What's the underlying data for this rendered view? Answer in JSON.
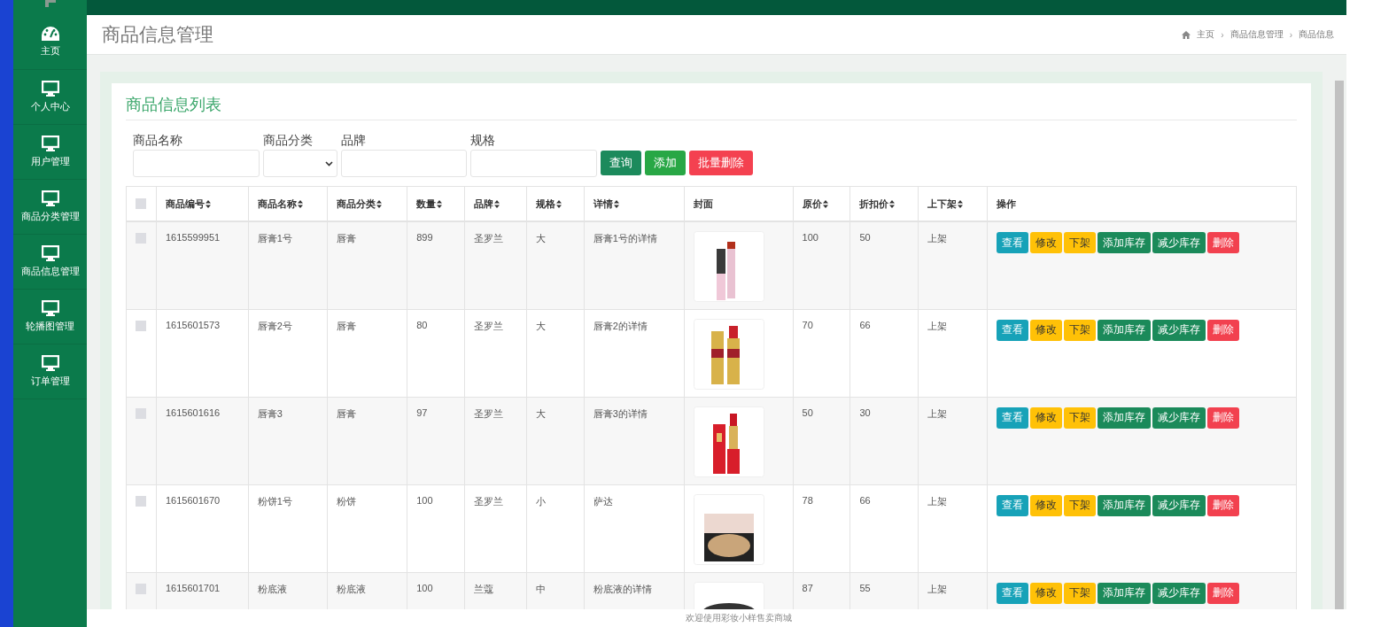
{
  "sidebar": {
    "items": [
      {
        "label": "主页"
      },
      {
        "label": "个人中心"
      },
      {
        "label": "用户管理"
      },
      {
        "label": "商品分类管理"
      },
      {
        "label": "商品信息管理"
      },
      {
        "label": "轮播图管理"
      },
      {
        "label": "订单管理"
      }
    ]
  },
  "header": {
    "title": "商品信息管理",
    "breadcrumb": [
      "主页",
      "商品信息管理",
      "商品信息"
    ],
    "breadcrumb_separators": [
      "›",
      "›"
    ]
  },
  "card": {
    "title": "商品信息列表",
    "filters": [
      {
        "label": "商品名称",
        "kind": "text"
      },
      {
        "label": "商品分类",
        "kind": "select"
      },
      {
        "label": "品牌",
        "kind": "text"
      },
      {
        "label": "规格",
        "kind": "text"
      }
    ],
    "buttons": [
      {
        "label": "查询",
        "kind": "search"
      },
      {
        "label": "添加",
        "kind": "add"
      },
      {
        "label": "批量删除",
        "kind": "delete"
      }
    ],
    "table": {
      "select_all": {
        "checked": false
      },
      "columns": [
        {
          "label": "商品编号",
          "sortable": true
        },
        {
          "label": "商品名称",
          "sortable": true
        },
        {
          "label": "商品分类",
          "sortable": true
        },
        {
          "label": "数量",
          "sortable": true
        },
        {
          "label": "品牌",
          "sortable": true
        },
        {
          "label": "规格",
          "sortable": true
        },
        {
          "label": "详情",
          "sortable": true
        },
        {
          "label": "封面",
          "sortable": false
        },
        {
          "label": "原价",
          "sortable": true
        },
        {
          "label": "折扣价",
          "sortable": true
        },
        {
          "label": "上下架",
          "sortable": true
        },
        {
          "label": "操作",
          "sortable": false
        }
      ],
      "rows": [
        {
          "checked": false,
          "cells": [
            "1615599951",
            "唇膏1号",
            "唇膏",
            "899",
            "圣罗兰",
            "大",
            "唇膏1号的详情",
            null,
            "100",
            "50",
            "上架"
          ],
          "actions": [
            {
              "label": "查看",
              "kind": "view"
            },
            {
              "label": "修改",
              "kind": "edit"
            },
            {
              "label": "下架",
              "kind": "shelf"
            },
            {
              "label": "添加库存",
              "kind": "add_stock"
            },
            {
              "label": "减少库存",
              "kind": "reduce_stock"
            },
            {
              "label": "删除",
              "kind": "delete"
            }
          ]
        },
        {
          "checked": false,
          "cells": [
            "1615601573",
            "唇膏2号",
            "唇膏",
            "80",
            "圣罗兰",
            "大",
            "唇膏2的详情",
            null,
            "70",
            "66",
            "上架"
          ],
          "actions": [
            {
              "label": "查看",
              "kind": "view"
            },
            {
              "label": "修改",
              "kind": "edit"
            },
            {
              "label": "下架",
              "kind": "shelf"
            },
            {
              "label": "添加库存",
              "kind": "add_stock"
            },
            {
              "label": "减少库存",
              "kind": "reduce_stock"
            },
            {
              "label": "删除",
              "kind": "delete"
            }
          ]
        },
        {
          "checked": false,
          "cells": [
            "1615601616",
            "唇膏3",
            "唇膏",
            "97",
            "圣罗兰",
            "大",
            "唇膏3的详情",
            null,
            "50",
            "30",
            "上架"
          ],
          "actions": [
            {
              "label": "查看",
              "kind": "view"
            },
            {
              "label": "修改",
              "kind": "edit"
            },
            {
              "label": "下架",
              "kind": "shelf"
            },
            {
              "label": "添加库存",
              "kind": "add_stock"
            },
            {
              "label": "减少库存",
              "kind": "reduce_stock"
            },
            {
              "label": "删除",
              "kind": "delete"
            }
          ]
        },
        {
          "checked": false,
          "cells": [
            "1615601670",
            "粉饼1号",
            "粉饼",
            "100",
            "圣罗兰",
            "小",
            "萨达",
            null,
            "78",
            "66",
            "上架"
          ],
          "actions": [
            {
              "label": "查看",
              "kind": "view"
            },
            {
              "label": "修改",
              "kind": "edit"
            },
            {
              "label": "下架",
              "kind": "shelf"
            },
            {
              "label": "添加库存",
              "kind": "add_stock"
            },
            {
              "label": "减少库存",
              "kind": "reduce_stock"
            },
            {
              "label": "删除",
              "kind": "delete"
            }
          ]
        },
        {
          "checked": false,
          "cells": [
            "1615601701",
            "粉底液",
            "粉底液",
            "100",
            "兰蔻",
            "中",
            "粉底液的详情",
            null,
            "87",
            "55",
            "上架"
          ],
          "actions": [
            {
              "label": "查看",
              "kind": "view"
            },
            {
              "label": "修改",
              "kind": "edit"
            },
            {
              "label": "下架",
              "kind": "shelf"
            },
            {
              "label": "添加库存",
              "kind": "add_stock"
            },
            {
              "label": "减少库存",
              "kind": "reduce_stock"
            },
            {
              "label": "删除",
              "kind": "delete"
            }
          ]
        }
      ]
    }
  },
  "footer": {
    "text": "欢迎使用彩妆小样售卖商城"
  }
}
